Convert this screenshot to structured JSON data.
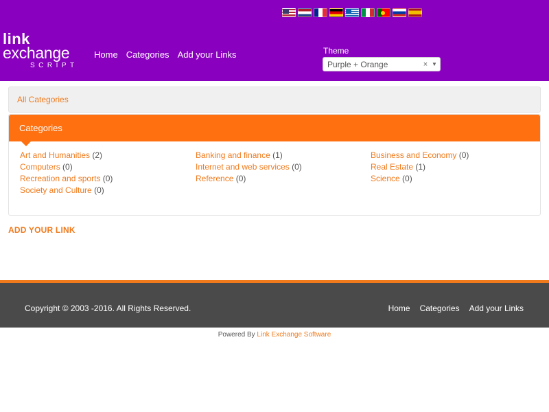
{
  "header": {
    "flags": [
      {
        "name": "flag-us-icon"
      },
      {
        "name": "flag-nl-icon"
      },
      {
        "name": "flag-fr-icon"
      },
      {
        "name": "flag-de-icon"
      },
      {
        "name": "flag-gr-icon"
      },
      {
        "name": "flag-it-icon"
      },
      {
        "name": "flag-pt-icon"
      },
      {
        "name": "flag-ru-icon"
      },
      {
        "name": "flag-es-icon"
      }
    ],
    "logo": {
      "line1": "link",
      "line2": "exchange",
      "line3": "SCRIPT"
    },
    "nav": {
      "home": "Home",
      "categories": "Categories",
      "add_links": "Add your Links"
    },
    "theme": {
      "label": "Theme",
      "selected": "Purple + Orange",
      "clear": "×",
      "caret": "▼"
    }
  },
  "breadcrumb": {
    "label": "All Categories"
  },
  "categories_panel": {
    "title": "Categories",
    "items": [
      {
        "name": "Art and Humanities",
        "count": "(2)"
      },
      {
        "name": "Banking and finance",
        "count": "(1)"
      },
      {
        "name": "Business and Economy",
        "count": "(0)"
      },
      {
        "name": "Computers",
        "count": "(0)"
      },
      {
        "name": "Internet and web services",
        "count": "(0)"
      },
      {
        "name": "Real Estate",
        "count": "(1)"
      },
      {
        "name": "Recreation and sports",
        "count": "(0)"
      },
      {
        "name": "Reference",
        "count": "(0)"
      },
      {
        "name": "Science",
        "count": "(0)"
      },
      {
        "name": "Society and Culture",
        "count": "(0)"
      }
    ]
  },
  "add_link": "ADD YOUR LINK",
  "footer": {
    "copyright": "Copyright © 2003 -2016. All Rights Reserved.",
    "nav": {
      "home": "Home",
      "categories": "Categories",
      "add_links": "Add your Links"
    }
  },
  "powered": {
    "prefix": "Powered By",
    "link": "Link Exchange Software"
  },
  "colors": {
    "header_bg": "#8a00bf",
    "accent": "#ff7010",
    "link": "#f07a1c",
    "footer_bg": "#4a4a4a"
  }
}
